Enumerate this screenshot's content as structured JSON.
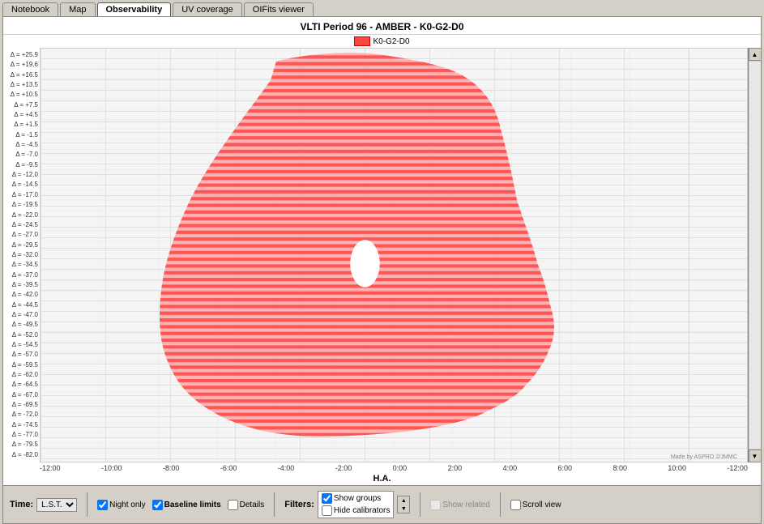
{
  "tabs": [
    {
      "label": "Notebook",
      "active": false
    },
    {
      "label": "Map",
      "active": false
    },
    {
      "label": "Observability",
      "active": true
    },
    {
      "label": "UV coverage",
      "active": false
    },
    {
      "label": "OIFits viewer",
      "active": false
    }
  ],
  "chart": {
    "title": "VLTI Period 96 - AMBER - K0-G2-D0",
    "x_axis": {
      "label": "H.A.",
      "ticks": [
        "-12:00",
        "-10:00",
        "-8:00",
        "-6:00",
        "-4:00",
        "-2:00",
        "0:00",
        "2:00",
        "4:00",
        "6:00",
        "8:00",
        "10:00",
        "-12:00"
      ]
    },
    "y_axis": {
      "ticks": [
        "Δ = +25.9",
        "Δ = +19.6",
        "Δ = +16.5",
        "Δ = +13.5",
        "Δ = +10.5",
        "Δ = +7.5",
        "Δ = +4.5",
        "Δ = +1.5",
        "Δ = -1.5",
        "Δ = -4.5",
        "Δ = -7.0",
        "Δ = -9.5",
        "Δ = -12.0",
        "Δ = -14.5",
        "Δ = -17.0",
        "Δ = -19.5",
        "Δ = -22.0",
        "Δ = -24.5",
        "Δ = -27.0",
        "Δ = -29.5",
        "Δ = -32.0",
        "Δ = -34.5",
        "Δ = -37.0",
        "Δ = -39.5",
        "Δ = -42.0",
        "Δ = -44.5",
        "Δ = -47.0",
        "Δ = -49.5",
        "Δ = -52.0",
        "Δ = -54.5",
        "Δ = -57.0",
        "Δ = -59.5",
        "Δ = -62.0",
        "Δ = -64.5",
        "Δ = -67.0",
        "Δ = -69.5",
        "Δ = -72.0",
        "Δ = -74.5",
        "Δ = -77.0",
        "Δ = -79.5",
        "Δ = -82.0"
      ]
    },
    "watermark": "Made by ASPRO 2/JMMC",
    "legend": [
      {
        "label": "K0-G2-D0",
        "color": "#ff4444"
      }
    ]
  },
  "controls": {
    "time_label": "Time:",
    "time_value": "L.S.T.",
    "night_only_label": "Night only",
    "night_only_checked": true,
    "baseline_limits_label": "Baseline limits",
    "baseline_limits_checked": true,
    "details_label": "Details",
    "details_checked": false,
    "filters_label": "Filters:",
    "show_groups_label": "Show groups",
    "show_groups_checked": true,
    "hide_calibrators_label": "Hide calibrators",
    "hide_calibrators_checked": false,
    "show_related_label": "Show related",
    "scroll_view_label": "Scroll view"
  }
}
